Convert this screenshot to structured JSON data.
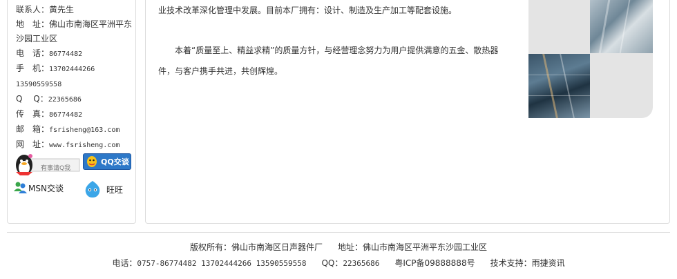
{
  "contact": {
    "person_label": "联系人：",
    "person": "黄先生",
    "address_label": "地　址：",
    "address": "佛山市南海区平洲平东沙园工业区",
    "phone_label": "电　话：",
    "phone": "86774482",
    "mobile_label": "手　机：",
    "mobile1": "13702444266",
    "mobile2": "13590559558",
    "qq_label": "Q　 Q：",
    "qq": "22365686",
    "fax_label": "传　真：",
    "fax": "86774482",
    "email_label": "邮　箱：",
    "email": "fsrisheng@163.com",
    "web_label": "网　址：",
    "web": "www.fsrisheng.com"
  },
  "im": {
    "qq_small_text": "有事请Q我",
    "qq_button": "QQ交谈",
    "msn_label": "MSN交谈",
    "wangwang_label": "旺旺"
  },
  "content": {
    "para1": "业技术改革深化管理中发展。目前本厂拥有：设计、制造及生产加工等配套设施。",
    "para2": "本着“质量至上、精益求精”的质量方针，与经营理念努力为用户提供满意的五金、散热器件，与客户携手共进，共创辉煌。"
  },
  "footer": {
    "copyright": "版权所有：佛山市南海区日声器件厂",
    "address": "地址：佛山市南海区平洲平东沙园工业区",
    "phone_label": "电话：",
    "phone_value": "0757-86774482 13702444266 13590559558",
    "qq_label": "QQ：",
    "qq_value": "22365686",
    "icp": "粤ICP备09888888号",
    "support": "技术支持：雨捷资讯"
  }
}
